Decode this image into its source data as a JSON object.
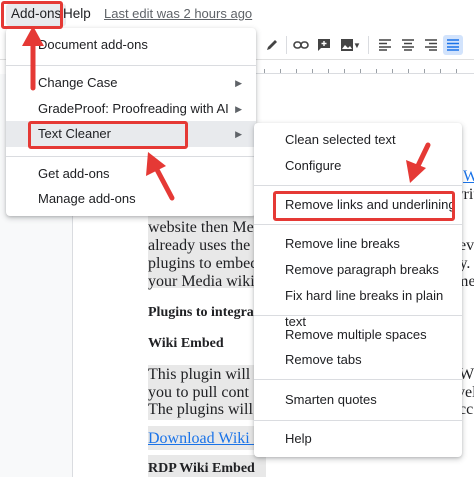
{
  "menubar": {
    "addons": "Add-ons",
    "help": "Help",
    "last_edit": "Last edit was 2 hours ago"
  },
  "toolbar": {
    "icons": [
      "pen-icon",
      "link-icon",
      "insert-comment-icon",
      "image-icon",
      "align-left-icon",
      "align-center-icon",
      "align-right-icon",
      "justify-icon"
    ]
  },
  "addons_menu": {
    "document_addons": "Document add-ons",
    "change_case": "Change Case",
    "gradeproof": "GradeProof: Proofreading with AI",
    "text_cleaner": "Text Cleaner",
    "get_addons": "Get add-ons",
    "manage_addons": "Manage add-ons"
  },
  "text_cleaner_menu": {
    "clean_selected": "Clean selected text",
    "configure": "Configure",
    "remove_links": "Remove links and underlining",
    "remove_line_breaks": "Remove line breaks",
    "remove_paragraph_breaks": "Remove paragraph breaks",
    "fix_hard_line_breaks": "Fix hard line breaks in plain text",
    "remove_multiple_spaces": "Remove multiple spaces",
    "remove_tabs": "Remove tabs",
    "smarten_quotes": "Smarten quotes",
    "help": "Help"
  },
  "document": {
    "line1_end": "W",
    "line2_a": "website then Me",
    "line2_b": "writ",
    "line3_a": "already uses the",
    "line3_b": "ev",
    "line4_a": "plugins to embed",
    "line4_b": "ty.",
    "line5_a": "your Media wiki",
    "line5_b": "me",
    "heading1": "Plugins to integrate",
    "heading2": "Wiki Embed",
    "para2_l1": "This plugin will",
    "para2_l1b": "W",
    "para2_l2": "you to pull cont",
    "para2_l2b": "vel",
    "para2_l3": "The plugins will",
    "para2_l3b": "cc",
    "link": "Download Wiki E",
    "heading3": "RDP Wiki Embed"
  }
}
